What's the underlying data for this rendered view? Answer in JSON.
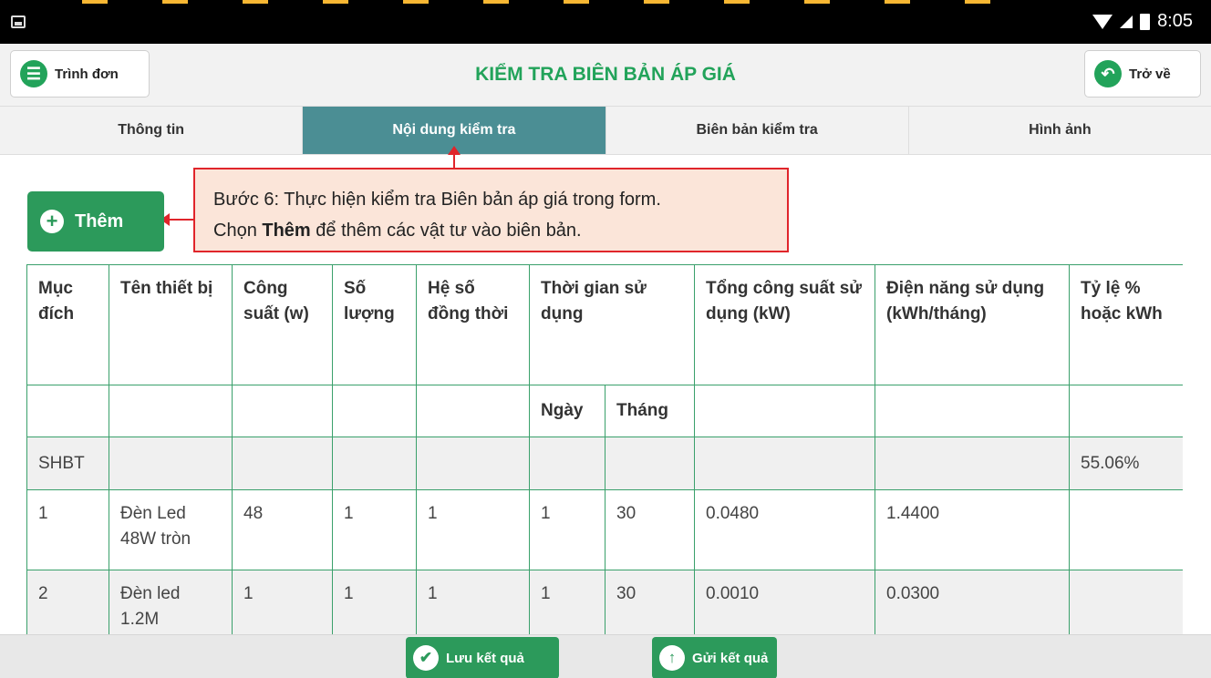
{
  "status_bar": {
    "time": "8:05"
  },
  "header": {
    "title": "KIỂM TRA BIÊN BẢN ÁP GIÁ",
    "menu_label": "Trình đơn",
    "back_label": "Trở về"
  },
  "tabs": [
    {
      "label": "Thông tin",
      "active": false
    },
    {
      "label": "Nội dung kiểm tra",
      "active": true
    },
    {
      "label": "Biên bản kiểm tra",
      "active": false
    },
    {
      "label": "Hình ảnh",
      "active": false
    }
  ],
  "add_button": {
    "label": "Thêm"
  },
  "callout": {
    "line1": "Bước 6: Thực hiện kiểm tra Biên bản áp giá trong form.",
    "line2_prefix": "Chọn ",
    "line2_bold": "Thêm",
    "line2_suffix": " để thêm các vật tư vào biên bản."
  },
  "table": {
    "headers": {
      "muc_dich": "Mục đích",
      "ten_thiet_bi": "Tên thiết bị",
      "cong_suat": "Công suất (w)",
      "so_luong": "Số lượng",
      "he_so": "Hệ số đồng thời",
      "thoi_gian": "Thời gian sử dụng",
      "tong_cong_suat": "Tổng công suất sử dụng (kW)",
      "dien_nang": "Điện năng sử dụng (kWh/tháng)",
      "ty_le": "Tỷ lệ % hoặc kWh",
      "ngay": "Ngày",
      "thang": "Tháng"
    },
    "category_row": {
      "name": "SHBT",
      "ratio": "55.06%"
    },
    "rows": [
      {
        "id": "1",
        "name": "Đèn Led 48W tròn",
        "power": "48",
        "qty": "1",
        "coef": "1",
        "day": "1",
        "month": "30",
        "total_kw": "0.0480",
        "energy": "1.4400"
      },
      {
        "id": "2",
        "name": "Đèn led 1.2M",
        "power": "1",
        "qty": "1",
        "coef": "1",
        "day": "1",
        "month": "30",
        "total_kw": "0.0010",
        "energy": "0.0300"
      }
    ]
  },
  "bottom": {
    "save_label": "Lưu kết quả",
    "send_label": "Gửi kết quả"
  },
  "colors": {
    "accent_green": "#22a35a",
    "active_tab": "#4b8e94",
    "callout_border": "#e0252b",
    "callout_fill": "#fbe5d9"
  }
}
